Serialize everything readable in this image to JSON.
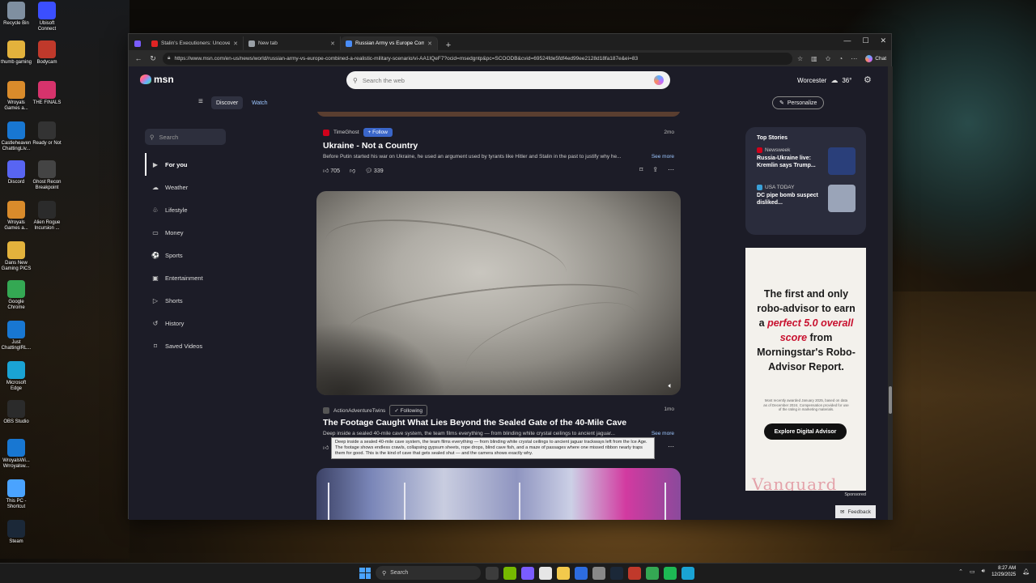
{
  "desktop": {
    "icons": [
      {
        "label": "Recycle Bin",
        "color": "#7f8fa0"
      },
      {
        "label": "Ubisoft Connect",
        "color": "#3b4fff"
      },
      {
        "label": "thumb gaming",
        "color": "#e3b23c"
      },
      {
        "label": "Bodycam",
        "color": "#c0392b"
      },
      {
        "label": "Wroyals Games a...",
        "color": "#d98b2b"
      },
      {
        "label": "THE FINALS",
        "color": "#d6336c"
      },
      {
        "label": "Castleheaven ChattingLiv...",
        "color": "#1877d2"
      },
      {
        "label": "Ready or Not",
        "color": "#333333"
      },
      {
        "label": "Discord",
        "color": "#5865f2"
      },
      {
        "label": "Ghost Recon Breakpoint",
        "color": "#444444"
      },
      {
        "label": "Wroyals Games a...",
        "color": "#d98b2b"
      },
      {
        "label": "Alien Rogue Incursion ...",
        "color": "#2b2b2b"
      },
      {
        "label": "Dans New Gaming PICS",
        "color": "#e3b23c"
      },
      {
        "label": "Google Chrome",
        "color": "#34a853"
      },
      {
        "label": "Just ChattingIRL...",
        "color": "#1877d2"
      },
      {
        "label": "Microsoft Edge",
        "color": "#1aa3d4"
      },
      {
        "label": "OBS Studio",
        "color": "#2b2b2b"
      },
      {
        "label": "WroyalsWi... Wrroyalsw...",
        "color": "#1877d2"
      },
      {
        "label": "This PC - Shortcut",
        "color": "#4aa3ff"
      },
      {
        "label": "Steam",
        "color": "#1b2838"
      }
    ]
  },
  "browser": {
    "tabs": [
      {
        "title": "Stalin's Executioners: Uncovering S",
        "favicon_color": "#e02424"
      },
      {
        "title": "New tab",
        "favicon_color": "#9aa0a6"
      },
      {
        "title": "Russian Army vs Europe Comb",
        "favicon_color": "#4a8df8"
      }
    ],
    "url": "https://www.msn.com/en-us/news/world/russian-army-vs-europe-combined-a-realistic-military-scenario/vi-AA1IQeF7?ocid=msedgntp&pc=SCOODB&cvid=69524fde5fdf4ed99ee2128d18fa187e&ei=83",
    "copilot_label": "Chat"
  },
  "msn": {
    "logo": "msn",
    "search_placeholder": "Search the web",
    "weather_city": "Worcester",
    "weather_temp": "36°",
    "nav_discover": "Discover",
    "nav_watch": "Watch",
    "personalize": "Personalize",
    "side_search": "Search",
    "side_items": [
      {
        "label": "For you",
        "icon": "for-you-icon",
        "glyph": "▶"
      },
      {
        "label": "Weather",
        "icon": "weather-icon",
        "glyph": "☁"
      },
      {
        "label": "Lifestyle",
        "icon": "lifestyle-icon",
        "glyph": "♧"
      },
      {
        "label": "Money",
        "icon": "money-icon",
        "glyph": "▭"
      },
      {
        "label": "Sports",
        "icon": "sports-icon",
        "glyph": "⚽"
      },
      {
        "label": "Entertainment",
        "icon": "entertainment-icon",
        "glyph": "▣"
      },
      {
        "label": "Shorts",
        "icon": "shorts-icon",
        "glyph": "▷"
      },
      {
        "label": "History",
        "icon": "history-icon",
        "glyph": "↺"
      },
      {
        "label": "Saved Videos",
        "icon": "bookmark-icon",
        "glyph": "⌑"
      }
    ]
  },
  "feed": {
    "card1": {
      "source": "TimeGhost",
      "follow": "Follow",
      "age": "2mo",
      "title": "Ukraine - Not a Country",
      "desc": "Before Putin started his war on Ukraine, he used an argument used by tyrants like Hitler and Stalin in the past to justify why he...",
      "see_more": "See more",
      "likes": "705",
      "comments": "339"
    },
    "card2": {
      "source": "ActionAdventureTwins",
      "following": "Following",
      "age": "1mo",
      "title": "The Footage Caught What Lies Beyond the Sealed Gate of the 40-Mile Cave",
      "desc": "Deep inside a sealed 40-mile cave system, the team films everything — from blinding white crystal ceilings to ancient jaguar...",
      "see_more": "See more",
      "tooltip": "Deep inside a sealed 40-mile cave system, the team films everything — from blinding white crystal ceilings to ancient jaguar trackways left from the Ice Age. The footage shows endless crawls, collapsing gypsum sheets, rope drops, blind cave fish, and a maze of passages where one missed ribbon nearly traps them for good. This is the kind of cave that gets sealed shut — and the camera shows exactly why."
    }
  },
  "top_stories": {
    "title": "Top Stories",
    "items": [
      {
        "source": "Newsweek",
        "headline": "Russia-Ukraine live: Kremlin says Trump...",
        "src_color": "#d0021b",
        "thumb_color": "#2a3f7a"
      },
      {
        "source": "USA TODAY",
        "headline": "DC pipe bomb suspect disliked...",
        "src_color": "#3aa0d8",
        "thumb_color": "#9aa4b8"
      }
    ]
  },
  "ad": {
    "line1": "The first and only robo-advisor to earn a",
    "highlight": "perfect 5.0 overall score",
    "line2": "from Morningstar's Robo-Advisor Report.",
    "fine_print": "Most recently awarded January 2025, based on data as of December 2024. Compensation provided for use of the rating in marketing materials.",
    "cta": "Explore Digital Advisor",
    "brand": "Vanguard",
    "sponsored": "Sponsored"
  },
  "feedback": "Feedback",
  "taskbar": {
    "search": "Search",
    "time": "8:27 AM",
    "date": "12/29/2025"
  }
}
